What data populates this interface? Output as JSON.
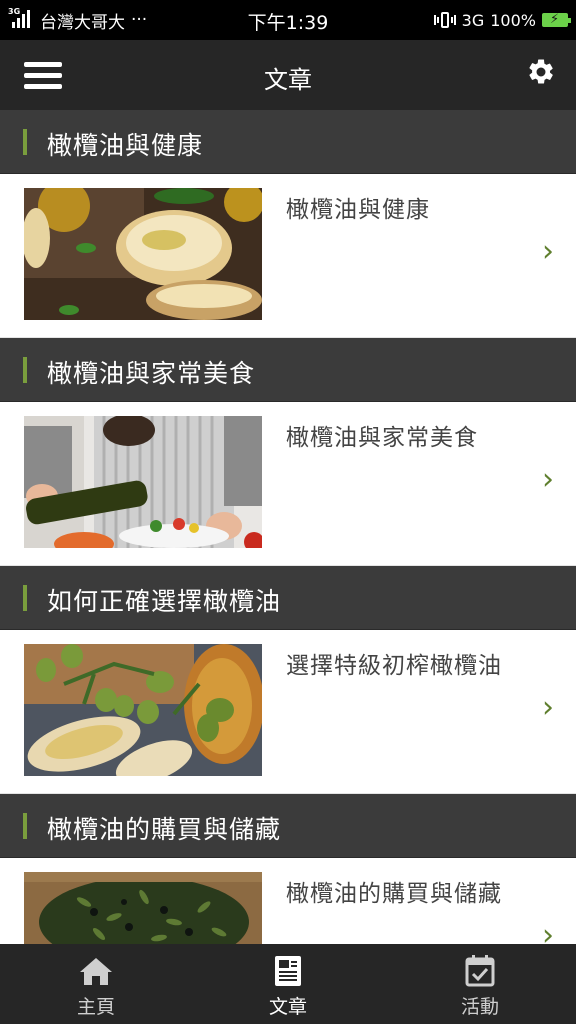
{
  "status_bar": {
    "network_tag": "3G",
    "carrier": "台灣大哥大",
    "more": "···",
    "time": "下午1:39",
    "network": "3G",
    "battery": "100%"
  },
  "app_bar": {
    "title": "文章",
    "menu_icon": "hamburger-menu-icon",
    "settings_icon": "gear-icon"
  },
  "sections": [
    {
      "header": "橄欖油與健康",
      "card_title": "橄欖油與健康",
      "image": "olive-oil-bread-photo"
    },
    {
      "header": "橄欖油與家常美食",
      "card_title": "橄欖油與家常美食",
      "image": "cooking-salad-photo"
    },
    {
      "header": "如何正確選擇橄欖油",
      "card_title": "選擇特級初榨橄欖油",
      "image": "green-olives-photo"
    },
    {
      "header": "橄欖油的購買與儲藏",
      "card_title": "橄欖油的購買與儲藏",
      "image": "olive-sack-photo"
    }
  ],
  "chevron": "›",
  "bottom_nav": [
    {
      "label": "主頁",
      "icon": "home-icon",
      "active": false
    },
    {
      "label": "文章",
      "icon": "article-icon",
      "active": true
    },
    {
      "label": "活動",
      "icon": "calendar-check-icon",
      "active": false
    }
  ],
  "colors": {
    "accent_green": "#7a9e3d",
    "chevron_green": "#5f7f2e",
    "header_bg": "#3b3b3b",
    "bar_bg": "#262626"
  }
}
